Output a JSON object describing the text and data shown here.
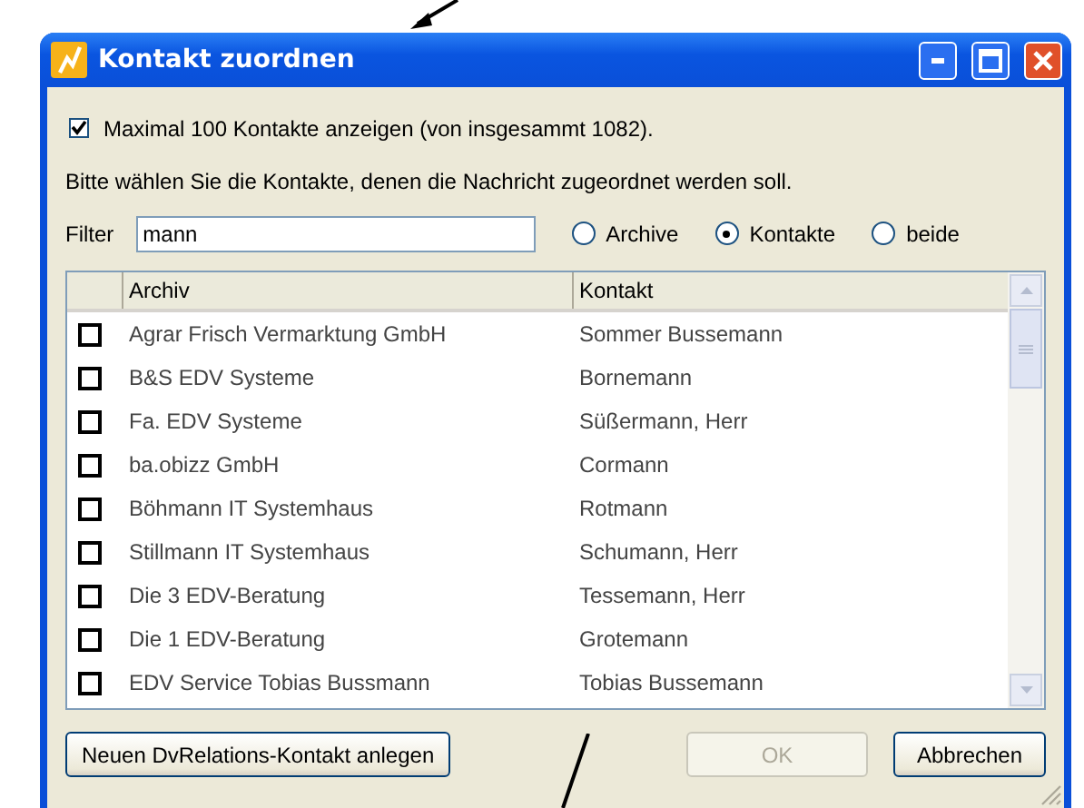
{
  "window": {
    "title": "Kontakt zuordnen"
  },
  "limit_option": {
    "label": "Maximal 100 Kontakte anzeigen (von insgesammt 1082).",
    "checked": true
  },
  "instruction": "Bitte wählen Sie die Kontakte, denen die Nachricht zugeordnet werden soll.",
  "filter": {
    "label": "Filter",
    "value": "mann"
  },
  "scope_options": [
    {
      "label": "Archive",
      "selected": false
    },
    {
      "label": "Kontakte",
      "selected": true
    },
    {
      "label": "beide",
      "selected": false
    }
  ],
  "table": {
    "columns": [
      "Archiv",
      "Kontakt"
    ],
    "rows": [
      {
        "checked": false,
        "cells": [
          "Agrar Frisch Vermarktung GmbH",
          "Sommer Bussemann"
        ]
      },
      {
        "checked": false,
        "cells": [
          "B&S EDV Systeme",
          "Bornemann"
        ]
      },
      {
        "checked": false,
        "cells": [
          "Fa. EDV Systeme",
          "Süßermann, Herr"
        ]
      },
      {
        "checked": false,
        "cells": [
          "ba.obizz GmbH",
          "Cormann"
        ]
      },
      {
        "checked": false,
        "cells": [
          "Böhmann IT Systemhaus",
          "Rotmann"
        ]
      },
      {
        "checked": false,
        "cells": [
          "Stillmann IT Systemhaus",
          "Schumann, Herr"
        ]
      },
      {
        "checked": false,
        "cells": [
          "Die 3 EDV-Beratung",
          "Tessemann, Herr"
        ]
      },
      {
        "checked": false,
        "cells": [
          "Die 1 EDV-Beratung",
          "Grotemann"
        ]
      },
      {
        "checked": false,
        "cells": [
          "EDV Service Tobias Bussmann",
          "Tobias Bussemann"
        ]
      }
    ]
  },
  "buttons": [
    {
      "label": "Neuen DvRelations-Kontakt anlegen",
      "disabled": false
    },
    {
      "label": "OK",
      "disabled": true
    },
    {
      "label": "Abbrechen",
      "disabled": false
    }
  ]
}
